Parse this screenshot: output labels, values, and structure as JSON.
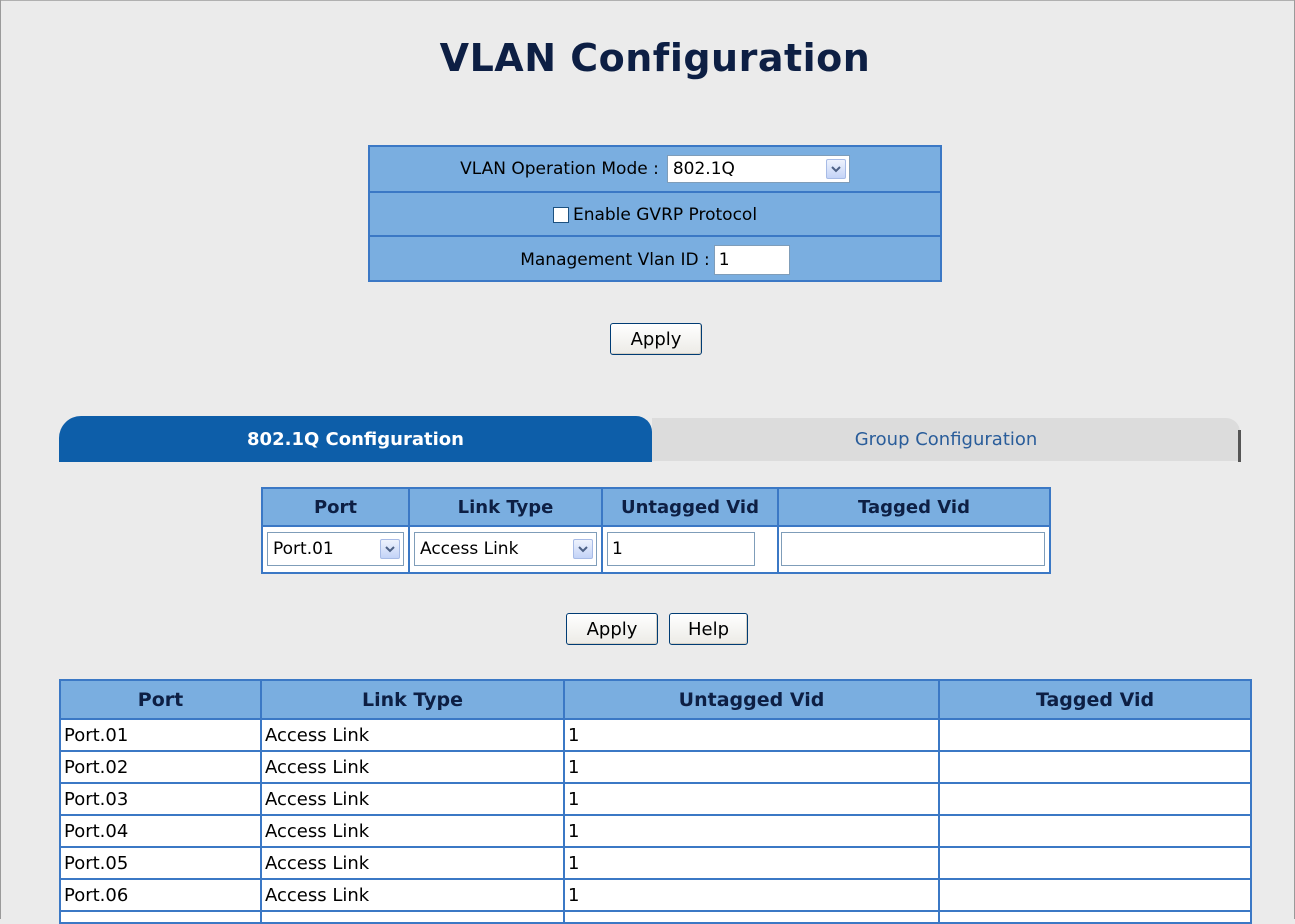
{
  "page_title": "VLAN Configuration",
  "settings": {
    "operation_mode_label": "VLAN Operation Mode :",
    "operation_mode_value": "802.1Q",
    "gvrp_label": "Enable GVRP Protocol",
    "gvrp_checked": false,
    "mgmt_vlan_label": "Management Vlan ID :",
    "mgmt_vlan_value": "1"
  },
  "apply_label": "Apply",
  "help_label": "Help",
  "tabs": [
    {
      "label": "802.1Q Configuration",
      "active": true
    },
    {
      "label": "Group Configuration",
      "active": false
    }
  ],
  "port_config": {
    "headers": [
      "Port",
      "Link Type",
      "Untagged Vid",
      "Tagged Vid"
    ],
    "port_value": "Port.01",
    "link_type_value": "Access Link",
    "untagged_value": "1",
    "tagged_value": ""
  },
  "port_table": {
    "headers": [
      "Port",
      "Link Type",
      "Untagged Vid",
      "Tagged Vid"
    ],
    "rows": [
      {
        "port": "Port.01",
        "link_type": "Access Link",
        "untagged": "1",
        "tagged": ""
      },
      {
        "port": "Port.02",
        "link_type": "Access Link",
        "untagged": "1",
        "tagged": ""
      },
      {
        "port": "Port.03",
        "link_type": "Access Link",
        "untagged": "1",
        "tagged": ""
      },
      {
        "port": "Port.04",
        "link_type": "Access Link",
        "untagged": "1",
        "tagged": ""
      },
      {
        "port": "Port.05",
        "link_type": "Access Link",
        "untagged": "1",
        "tagged": ""
      },
      {
        "port": "Port.06",
        "link_type": "Access Link",
        "untagged": "1",
        "tagged": ""
      }
    ]
  },
  "colors": {
    "header_blue": "#7aaee0",
    "border_blue": "#3b78c5",
    "active_tab": "#0d5ea9",
    "title": "#0d1f44"
  }
}
